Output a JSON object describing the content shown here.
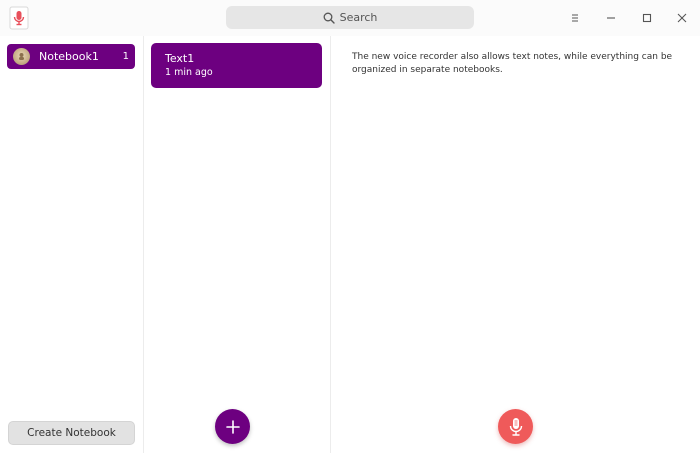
{
  "window": {
    "app_icon": "voice-recorder-icon",
    "search_placeholder": "Search",
    "controls": [
      "menu-icon",
      "minimize-icon",
      "maximize-icon",
      "close-icon"
    ]
  },
  "sidebar": {
    "notebooks": [
      {
        "label": "Notebook1",
        "count": "1"
      }
    ],
    "create_label": "Create Notebook"
  },
  "notes": {
    "items": [
      {
        "title": "Text1",
        "time": "1 min ago"
      }
    ],
    "add_icon": "plus-icon"
  },
  "editor": {
    "content": "The new voice recorder also allows text notes, while everything can be organized in separate notebooks.",
    "record_icon": "microphone-icon"
  },
  "colors": {
    "accent": "#6d0080",
    "record": "#ef5a5a"
  }
}
